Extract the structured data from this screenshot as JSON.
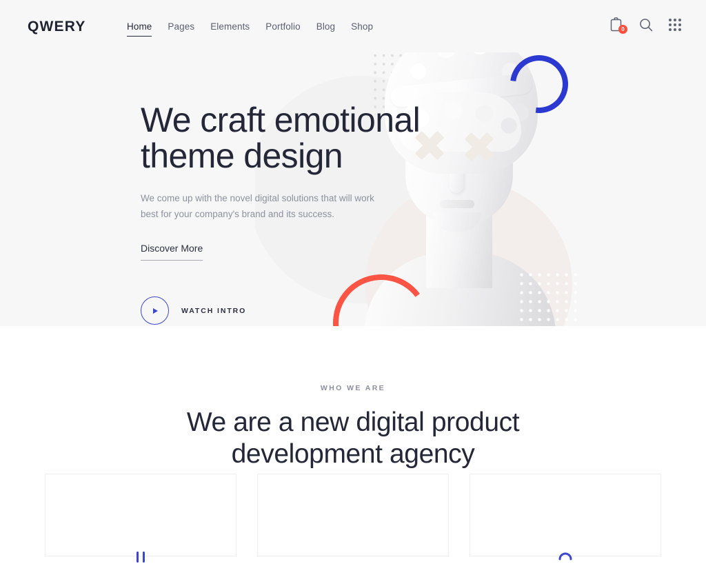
{
  "brand": {
    "name": "QWERY"
  },
  "nav": {
    "items": [
      {
        "label": "Home",
        "active": true
      },
      {
        "label": "Pages",
        "active": false
      },
      {
        "label": "Elements",
        "active": false
      },
      {
        "label": "Portfolio",
        "active": false
      },
      {
        "label": "Blog",
        "active": false
      },
      {
        "label": "Shop",
        "active": false
      }
    ]
  },
  "header_actions": {
    "cart": {
      "icon": "cart-clipboard-icon",
      "badge_count": "0"
    },
    "search": {
      "icon": "search-icon"
    },
    "apps": {
      "icon": "grid-menu-icon"
    }
  },
  "hero": {
    "title_line1": "We craft emotional",
    "title_line2": "theme design",
    "subtitle": "We come up with the novel digital solutions that will work best for your company's brand and its success.",
    "cta_link": "Discover More",
    "watch_label": "WATCH INTRO",
    "play_icon": "play-triangle-icon",
    "art": {
      "subject": "classical-marble-bust-statue",
      "eye_marks": "x-cross-overlay",
      "decor": [
        "blue-open-ring",
        "red-open-ring",
        "grey-dot-grid",
        "white-dot-grid",
        "beige-circle"
      ]
    }
  },
  "about": {
    "eyebrow": "WHO WE ARE",
    "title_line1": "We are a new digital product",
    "title_line2": "development agency"
  },
  "cards": [
    {
      "icon": "two-bars-icon"
    },
    {
      "icon": "blank-icon"
    },
    {
      "icon": "arch-icon"
    }
  ],
  "colors": {
    "hero_background": "#f7f7f8",
    "page_background": "#ffffff",
    "heading": "#232737",
    "body_text": "#8d919f",
    "accent_blue": "#2b39d1",
    "accent_red": "#fb5444",
    "badge_red": "#fb4e3d",
    "beige": "#f3eeeb",
    "border": "#ededf0"
  }
}
